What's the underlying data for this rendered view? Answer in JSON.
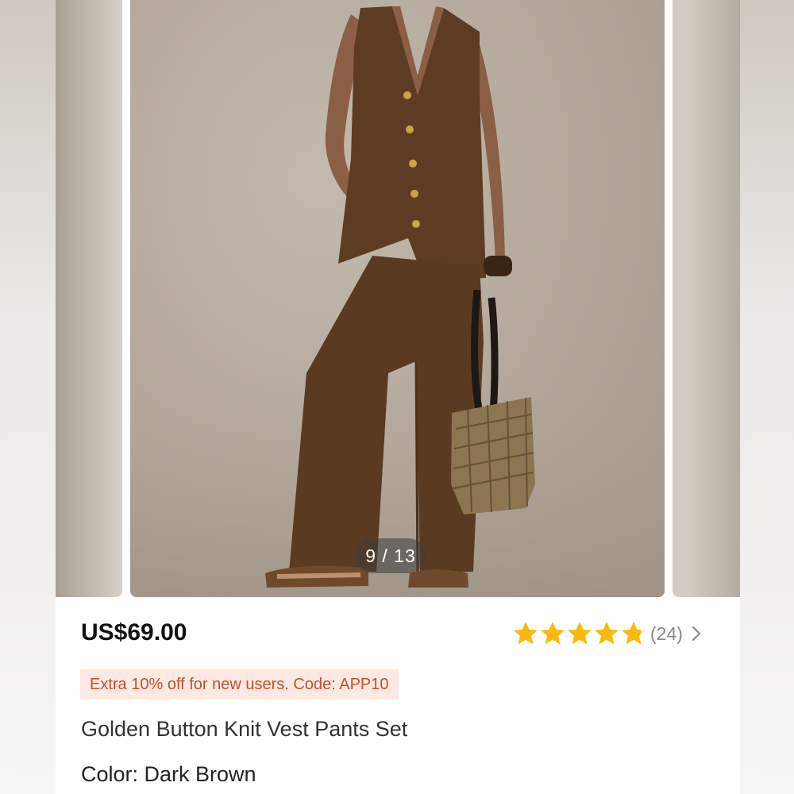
{
  "product": {
    "price": "US$69.00",
    "rating_value": 4.8,
    "rating_max": 5,
    "review_count": "(24)",
    "promo": "Extra 10% off for new users. Code: APP10",
    "title": "Golden Button Knit Vest Pants Set",
    "color_label": "Color: Dark Brown"
  },
  "gallery": {
    "counter": "9 / 13"
  },
  "colors": {
    "star": "#f9b90f",
    "price": "#111111",
    "promo_bg": "#fde9e2",
    "promo_text": "#c1512c",
    "garment": "#5b3a22"
  },
  "icons": {
    "star": "star-icon",
    "chevron": "chevron-right-icon"
  }
}
